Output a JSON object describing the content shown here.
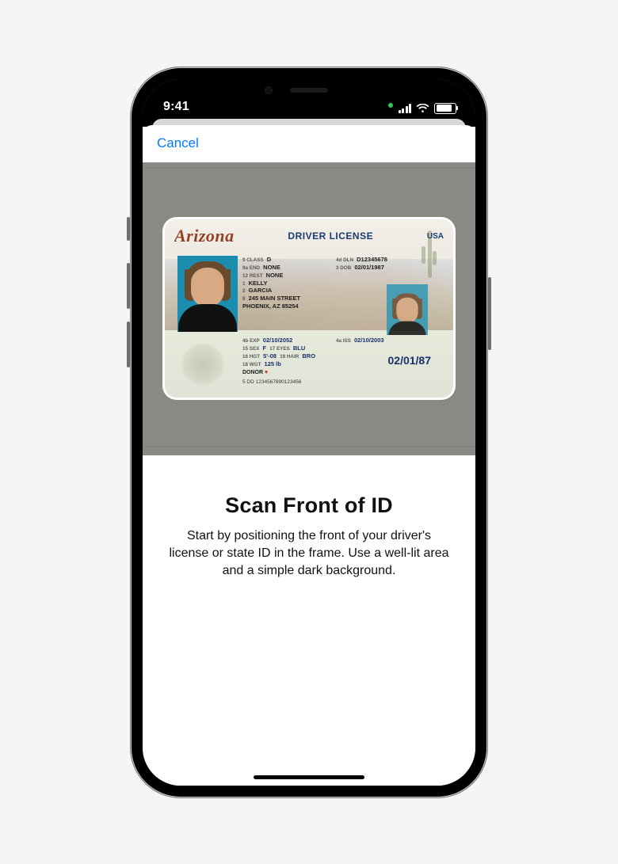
{
  "status": {
    "time": "9:41"
  },
  "nav": {
    "cancel_label": "Cancel"
  },
  "license": {
    "state": "Arizona",
    "doc_type": "DRIVER LICENSE",
    "country": "USA",
    "class_label": "9 CLASS",
    "class_value": "D",
    "end_label": "9a END",
    "end_value": "NONE",
    "rest_label": "12 REST",
    "rest_value": "NONE",
    "last_label": "1",
    "last_name": "KELLY",
    "first_label": "2",
    "first_name": "GARCIA",
    "addr_label": "8",
    "addr_line1": "245 MAIN STREET",
    "addr_line2": "PHOENIX, AZ 85254",
    "dln_label": "4d DLN",
    "dln_value": "D12345678",
    "dob_label": "3 DOB",
    "dob_value": "02/01/1987",
    "exp_label": "4b EXP",
    "exp_value": "02/10/2052",
    "iss_label": "4a ISS",
    "iss_value": "02/10/2003",
    "sex_label": "15 SEX",
    "sex_value": "F",
    "eyes_label": "17 EYES",
    "eyes_value": "BLU",
    "hgt_label": "16 HGT",
    "hgt_value": "5'-08",
    "hair_label": "19 HAIR",
    "hair_value": "BRO",
    "wgt_label": "18 WGT",
    "wgt_value": "125 lb",
    "donor_label": "DONOR",
    "dob_big": "02/01/87",
    "dd_label": "5 DD",
    "dd_value": "1234567890123456"
  },
  "instructions": {
    "title": "Scan Front of ID",
    "body": "Start by positioning the front of your driver's license or state ID in the frame. Use a well-lit area and a simple dark background."
  }
}
